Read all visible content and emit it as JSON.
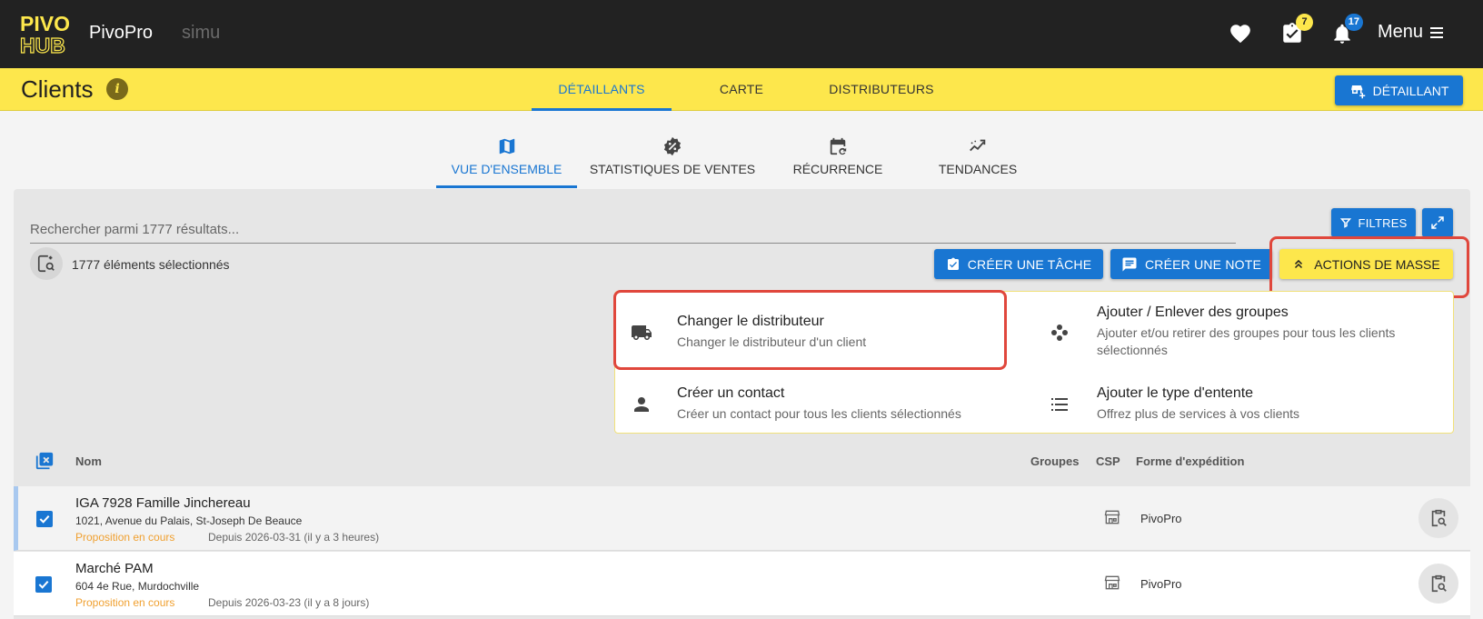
{
  "app": {
    "logo_text_1": "PIVO",
    "logo_text_2": "HUB",
    "name": "PivoPro",
    "env": "simu"
  },
  "topbar": {
    "favorites_icon": "heart-icon",
    "tasks_icon": "task-check-icon",
    "tasks_badge": "7",
    "notifications_icon": "bell-icon",
    "notifications_badge": "17",
    "menu_label": "Menu",
    "menu_icon": "hamburger-icon"
  },
  "header": {
    "title": "Clients",
    "info_icon": "info-icon",
    "tabs": [
      {
        "label": "DÉTAILLANTS",
        "active": true
      },
      {
        "label": "CARTE",
        "active": false
      },
      {
        "label": "DISTRIBUTEURS",
        "active": false
      }
    ],
    "add_button_label": "DÉTAILLANT"
  },
  "subtabs": [
    {
      "label": "VUE D'ENSEMBLE",
      "icon": "map-icon",
      "active": true
    },
    {
      "label": "STATISTIQUES DE VENTES",
      "icon": "percent-badge-icon",
      "active": false
    },
    {
      "label": "RÉCURRENCE",
      "icon": "calendar-refresh-icon",
      "active": false
    },
    {
      "label": "TENDANCES",
      "icon": "trend-icon",
      "active": false
    }
  ],
  "toolbar": {
    "search_placeholder": "Rechercher parmi 1777 résultats...",
    "filters_label": "FILTRES",
    "selected_text": "1777 éléments sélectionnés",
    "create_task_label": "CRÉER UNE TÂCHE",
    "create_note_label": "CRÉER UNE NOTE",
    "mass_actions_label": "ACTIONS DE MASSE"
  },
  "mass_actions": [
    {
      "title": "Changer le distributeur",
      "subtitle": "Changer le distributeur d'un client",
      "icon": "truck-icon"
    },
    {
      "title": "Ajouter / Enlever des groupes",
      "subtitle": "Ajouter et/ou retirer des groupes pour tous les clients sélectionnés",
      "icon": "group-dots-icon"
    },
    {
      "title": "Créer un contact",
      "subtitle": "Créer un contact pour tous les clients sélectionnés",
      "icon": "person-icon"
    },
    {
      "title": "Ajouter le type d'entente",
      "subtitle": "Offrez plus de services à vos clients",
      "icon": "list-icon"
    }
  ],
  "table": {
    "columns": {
      "name": "Nom",
      "groups": "Groupes",
      "csp": "CSP",
      "shipping": "Forme d'expédition"
    },
    "rows": [
      {
        "name": "IGA 7928 Famille Jinchereau",
        "address": "1021, Avenue du Palais, St-Joseph De Beauce",
        "status": "Proposition en cours",
        "since": "Depuis 2026-03-31 (il y a 3 heures)",
        "shipping": "PivoPro",
        "checked": true
      },
      {
        "name": "Marché PAM",
        "address": "604 4e Rue, Murdochville",
        "status": "Proposition en cours",
        "since": "Depuis 2026-03-23 (il y a 8 jours)",
        "shipping": "PivoPro",
        "checked": true
      }
    ]
  },
  "colors": {
    "brand_yellow": "#fde74c",
    "primary_blue": "#1976d2",
    "topbar": "#222222",
    "highlight_red": "#e0473c",
    "status_orange": "#f0a030"
  }
}
